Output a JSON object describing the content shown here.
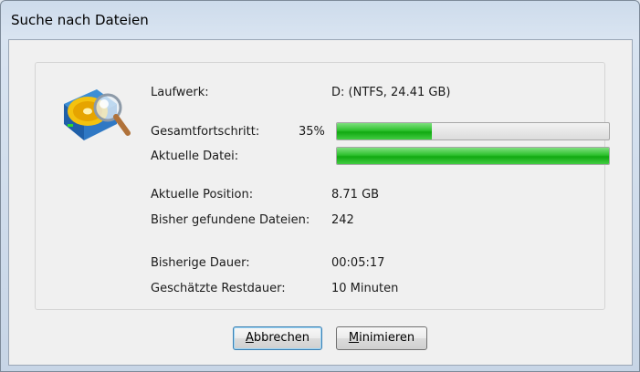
{
  "window": {
    "title": "Suche nach Dateien"
  },
  "fields": {
    "drive": {
      "label": "Laufwerk:",
      "value": "D: (NTFS, 24.41 GB)"
    },
    "overall_progress": {
      "label": "Gesamtfortschritt:",
      "percent_text": "35%",
      "percent": 35
    },
    "current_file": {
      "label": "Aktuelle Datei:",
      "percent": 100
    },
    "current_position": {
      "label": "Aktuelle Position:",
      "value": "8.71 GB"
    },
    "files_found": {
      "label": "Bisher gefundene Dateien:",
      "value": "242"
    },
    "elapsed": {
      "label": "Bisherige Dauer:",
      "value": "00:05:17"
    },
    "remaining": {
      "label": "Geschätzte Restdauer:",
      "value": "10 Minuten"
    }
  },
  "buttons": {
    "cancel": {
      "accel": "A",
      "rest": "bbrechen"
    },
    "minimize": {
      "accel": "M",
      "rest": "inimieren"
    }
  },
  "icons": {
    "drive": "hard-drive-magnifier-icon"
  },
  "colors": {
    "progress_fill": "#22b822",
    "title_bar": "#d9e4f1"
  }
}
